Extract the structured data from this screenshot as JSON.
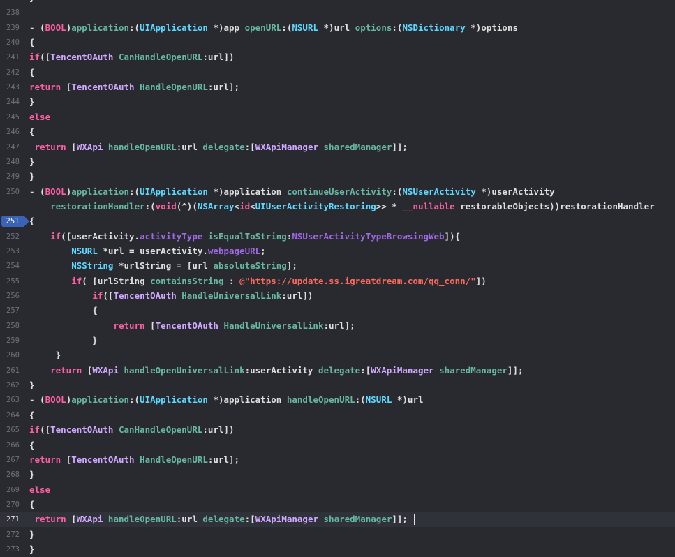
{
  "editor": {
    "language": "Objective-C",
    "theme_colors": {
      "background": "#292a30",
      "line_number": "#6c7078",
      "plain_text": "#dfdfe0",
      "keyword": "#fc5fa3",
      "type": "#5dd8ff",
      "method": "#67b7a4",
      "class": "#d0a8ff",
      "property": "#a167e6",
      "string": "#fc6a5d",
      "breakpoint_marker": "#3a63b8"
    },
    "breakpoint_line": "251",
    "cursor_line": "271",
    "lines": [
      {
        "num": "237",
        "tokens": [
          [
            "plain",
            "}"
          ]
        ]
      },
      {
        "num": "238",
        "tokens": []
      },
      {
        "num": "239",
        "tokens": [
          [
            "plain",
            "- ("
          ],
          [
            "kw",
            "BOOL"
          ],
          [
            "plain",
            ")"
          ],
          [
            "method",
            "application"
          ],
          [
            "plain",
            ":("
          ],
          [
            "type",
            "UIApplication"
          ],
          [
            "plain",
            " *)app "
          ],
          [
            "method",
            "openURL"
          ],
          [
            "plain",
            ":("
          ],
          [
            "type",
            "NSURL"
          ],
          [
            "plain",
            " *)url "
          ],
          [
            "method",
            "options"
          ],
          [
            "plain",
            ":("
          ],
          [
            "type",
            "NSDictionary"
          ],
          [
            "plain",
            " *)options"
          ]
        ]
      },
      {
        "num": "240",
        "tokens": [
          [
            "plain",
            "{"
          ]
        ]
      },
      {
        "num": "241",
        "tokens": [
          [
            "kw",
            "if"
          ],
          [
            "plain",
            "(["
          ],
          [
            "class",
            "TencentOAuth"
          ],
          [
            "plain",
            " "
          ],
          [
            "method",
            "CanHandleOpenURL"
          ],
          [
            "plain",
            ":url])"
          ]
        ]
      },
      {
        "num": "242",
        "tokens": [
          [
            "plain",
            "{"
          ]
        ]
      },
      {
        "num": "243",
        "tokens": [
          [
            "kw",
            "return"
          ],
          [
            "plain",
            " ["
          ],
          [
            "class",
            "TencentOAuth"
          ],
          [
            "plain",
            " "
          ],
          [
            "method",
            "HandleOpenURL"
          ],
          [
            "plain",
            ":url];"
          ]
        ]
      },
      {
        "num": "244",
        "tokens": [
          [
            "plain",
            "}"
          ]
        ]
      },
      {
        "num": "245",
        "tokens": [
          [
            "kw",
            "else"
          ]
        ]
      },
      {
        "num": "246",
        "tokens": [
          [
            "plain",
            "{"
          ]
        ]
      },
      {
        "num": "247",
        "tokens": [
          [
            "plain",
            " "
          ],
          [
            "kw",
            "return"
          ],
          [
            "plain",
            " ["
          ],
          [
            "class",
            "WXApi"
          ],
          [
            "plain",
            " "
          ],
          [
            "method",
            "handleOpenURL"
          ],
          [
            "plain",
            ":url "
          ],
          [
            "method",
            "delegate"
          ],
          [
            "plain",
            ":["
          ],
          [
            "class",
            "WXApiManager"
          ],
          [
            "plain",
            " "
          ],
          [
            "method",
            "sharedManager"
          ],
          [
            "plain",
            "]];"
          ]
        ]
      },
      {
        "num": "248",
        "tokens": [
          [
            "plain",
            "}"
          ]
        ]
      },
      {
        "num": "249",
        "tokens": [
          [
            "plain",
            "}"
          ]
        ]
      },
      {
        "num": "250",
        "tokens": [
          [
            "plain",
            "- ("
          ],
          [
            "kw",
            "BOOL"
          ],
          [
            "plain",
            ")"
          ],
          [
            "method",
            "application"
          ],
          [
            "plain",
            ":("
          ],
          [
            "type",
            "UIApplication"
          ],
          [
            "plain",
            " *)application "
          ],
          [
            "method",
            "continueUserActivity"
          ],
          [
            "plain",
            ":("
          ],
          [
            "type",
            "NSUserActivity"
          ],
          [
            "plain",
            " *)userActivity"
          ]
        ]
      },
      {
        "num": "",
        "tokens": [
          [
            "plain",
            "    "
          ],
          [
            "method",
            "restorationHandler"
          ],
          [
            "plain",
            ":("
          ],
          [
            "kw",
            "void"
          ],
          [
            "plain",
            "(^)("
          ],
          [
            "type",
            "NSArray"
          ],
          [
            "plain",
            "<"
          ],
          [
            "kw",
            "id"
          ],
          [
            "plain",
            "<"
          ],
          [
            "type",
            "UIUserActivityRestoring"
          ],
          [
            "plain",
            ">> * "
          ],
          [
            "kw",
            "__nullable"
          ],
          [
            "plain",
            " restorableObjects))restorationHandler"
          ]
        ]
      },
      {
        "num": "251",
        "tokens": [
          [
            "plain",
            "{"
          ]
        ]
      },
      {
        "num": "252",
        "tokens": [
          [
            "plain",
            "    "
          ],
          [
            "kw",
            "if"
          ],
          [
            "plain",
            "([userActivity."
          ],
          [
            "prop",
            "activityType"
          ],
          [
            "plain",
            " "
          ],
          [
            "method",
            "isEqualToString"
          ],
          [
            "plain",
            ":"
          ],
          [
            "const",
            "NSUserActivityTypeBrowsingWeb"
          ],
          [
            "plain",
            "]){"
          ]
        ]
      },
      {
        "num": "253",
        "tokens": [
          [
            "plain",
            "        "
          ],
          [
            "type",
            "NSURL"
          ],
          [
            "plain",
            " *url = userActivity."
          ],
          [
            "prop",
            "webpageURL"
          ],
          [
            "plain",
            ";"
          ]
        ]
      },
      {
        "num": "254",
        "tokens": [
          [
            "plain",
            "        "
          ],
          [
            "type",
            "NSString"
          ],
          [
            "plain",
            " *urlString = [url "
          ],
          [
            "method",
            "absoluteString"
          ],
          [
            "plain",
            "];"
          ]
        ]
      },
      {
        "num": "255",
        "tokens": [
          [
            "plain",
            "        "
          ],
          [
            "kw",
            "if"
          ],
          [
            "plain",
            "( [urlString "
          ],
          [
            "method",
            "containsString"
          ],
          [
            "plain",
            " : "
          ],
          [
            "str",
            "@\"https://update.ss.igreatdream.com/qq_conn/\""
          ],
          [
            "plain",
            "])"
          ]
        ]
      },
      {
        "num": "256",
        "tokens": [
          [
            "plain",
            "            "
          ],
          [
            "kw",
            "if"
          ],
          [
            "plain",
            "(["
          ],
          [
            "class",
            "TencentOAuth"
          ],
          [
            "plain",
            " "
          ],
          [
            "method",
            "HandleUniversalLink"
          ],
          [
            "plain",
            ":url])"
          ]
        ]
      },
      {
        "num": "257",
        "tokens": [
          [
            "plain",
            "            {"
          ]
        ]
      },
      {
        "num": "258",
        "tokens": [
          [
            "plain",
            "                "
          ],
          [
            "kw",
            "return"
          ],
          [
            "plain",
            " ["
          ],
          [
            "class",
            "TencentOAuth"
          ],
          [
            "plain",
            " "
          ],
          [
            "method",
            "HandleUniversalLink"
          ],
          [
            "plain",
            ":url];"
          ]
        ]
      },
      {
        "num": "259",
        "tokens": [
          [
            "plain",
            "            }"
          ]
        ]
      },
      {
        "num": "260",
        "tokens": [
          [
            "plain",
            "     }"
          ]
        ]
      },
      {
        "num": "261",
        "tokens": [
          [
            "plain",
            "    "
          ],
          [
            "kw",
            "return"
          ],
          [
            "plain",
            " ["
          ],
          [
            "class",
            "WXApi"
          ],
          [
            "plain",
            " "
          ],
          [
            "method",
            "handleOpenUniversalLink"
          ],
          [
            "plain",
            ":userActivity "
          ],
          [
            "method",
            "delegate"
          ],
          [
            "plain",
            ":["
          ],
          [
            "class",
            "WXApiManager"
          ],
          [
            "plain",
            " "
          ],
          [
            "method",
            "sharedManager"
          ],
          [
            "plain",
            "]];"
          ]
        ]
      },
      {
        "num": "262",
        "tokens": [
          [
            "plain",
            "}"
          ]
        ]
      },
      {
        "num": "263",
        "tokens": [
          [
            "plain",
            "- ("
          ],
          [
            "kw",
            "BOOL"
          ],
          [
            "plain",
            ")"
          ],
          [
            "method",
            "application"
          ],
          [
            "plain",
            ":("
          ],
          [
            "type",
            "UIApplication"
          ],
          [
            "plain",
            " *)application "
          ],
          [
            "method",
            "handleOpenURL"
          ],
          [
            "plain",
            ":("
          ],
          [
            "type",
            "NSURL"
          ],
          [
            "plain",
            " *)url"
          ]
        ]
      },
      {
        "num": "264",
        "tokens": [
          [
            "plain",
            "{"
          ]
        ]
      },
      {
        "num": "265",
        "tokens": [
          [
            "kw",
            "if"
          ],
          [
            "plain",
            "(["
          ],
          [
            "class",
            "TencentOAuth"
          ],
          [
            "plain",
            " "
          ],
          [
            "method",
            "CanHandleOpenURL"
          ],
          [
            "plain",
            ":url])"
          ]
        ]
      },
      {
        "num": "266",
        "tokens": [
          [
            "plain",
            "{"
          ]
        ]
      },
      {
        "num": "267",
        "tokens": [
          [
            "kw",
            "return"
          ],
          [
            "plain",
            " ["
          ],
          [
            "class",
            "TencentOAuth"
          ],
          [
            "plain",
            " "
          ],
          [
            "method",
            "HandleOpenURL"
          ],
          [
            "plain",
            ":url];"
          ]
        ]
      },
      {
        "num": "268",
        "tokens": [
          [
            "plain",
            "}"
          ]
        ]
      },
      {
        "num": "269",
        "tokens": [
          [
            "kw",
            "else"
          ]
        ]
      },
      {
        "num": "270",
        "tokens": [
          [
            "plain",
            "{"
          ]
        ]
      },
      {
        "num": "271",
        "tokens": [
          [
            "plain",
            " "
          ],
          [
            "kw",
            "return"
          ],
          [
            "plain",
            " ["
          ],
          [
            "class",
            "WXApi"
          ],
          [
            "plain",
            " "
          ],
          [
            "method",
            "handleOpenURL"
          ],
          [
            "plain",
            ":url "
          ],
          [
            "method",
            "delegate"
          ],
          [
            "plain",
            ":["
          ],
          [
            "class",
            "WXApiManager"
          ],
          [
            "plain",
            " "
          ],
          [
            "method",
            "sharedManager"
          ],
          [
            "plain",
            "]]; "
          ]
        ]
      },
      {
        "num": "272",
        "tokens": [
          [
            "plain",
            "}"
          ]
        ]
      },
      {
        "num": "273",
        "tokens": [
          [
            "plain",
            "}"
          ]
        ]
      }
    ]
  }
}
